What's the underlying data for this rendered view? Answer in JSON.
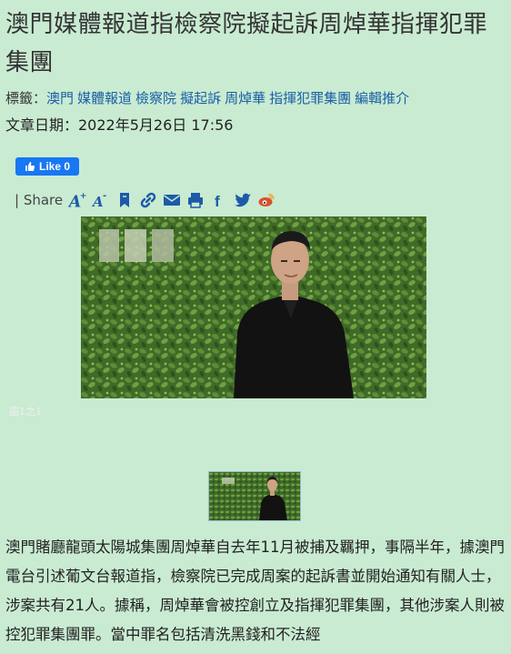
{
  "article": {
    "title": "澳門媒體報道指檢察院擬起訴周焯華指揮犯罪集團",
    "tags_label": "標籤：",
    "tags": [
      "澳門",
      "媒體報道",
      "檢察院",
      "擬起訴",
      "周焯華",
      "指揮犯罪集團",
      "編輯推介"
    ],
    "date": "文章日期：2022年5月26日 17:56",
    "body": "澳門賭廳龍頭太陽城集團周焯華自去年11月被捕及羈押，事隔半年，據澳門電台引述葡文台報道指，檢察院已完成周案的起訴書並開始通知有關人士，涉案共有21人。據稱，周焯華會被控創立及指揮犯罪集團，其他涉案人則被控犯罪集團罪。當中罪名包括清洗黑錢和不法經"
  },
  "social": {
    "like_label": "Like 0",
    "share_label": "| Share",
    "icons": [
      "font-increase-icon",
      "font-decrease-icon",
      "bookmark-icon",
      "link-icon",
      "email-icon",
      "print-icon",
      "facebook-icon",
      "twitter-icon",
      "weibo-icon"
    ]
  },
  "photo": {
    "caption": "圖1之1"
  },
  "colors": {
    "background": "#c9ebd2",
    "link": "#1a5fa6",
    "facebook": "#1877f2",
    "icon": "#1e5aa8"
  }
}
